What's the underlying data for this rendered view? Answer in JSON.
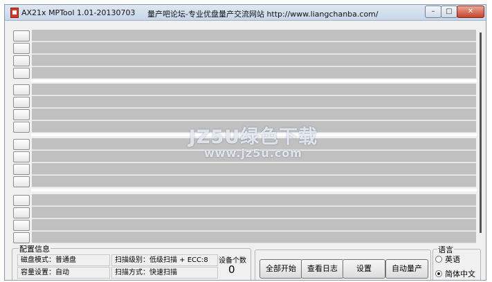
{
  "window": {
    "title": "AX21x MPTool 1.01-20130703",
    "site": "量产吧论坛-专业优盘量产交流网站 http://www.liangchanba.com/",
    "min_glyph": "–",
    "max_glyph": "□",
    "close_glyph": "✕"
  },
  "watermark": {
    "line1": "JZ5U绿色下载",
    "line2": "www.jz5u.com"
  },
  "config": {
    "title": "配置信息",
    "disk_mode": "磁盘模式：普通盘",
    "scan_level": "扫描级别：低级扫描 + ECC:8",
    "capacity": "容量设置：自动",
    "scan_method": "扫描方式：快速扫描"
  },
  "device_count": {
    "label": "设备个数",
    "value": "0"
  },
  "actions": {
    "start_all": "全部开始",
    "view_log": "查看日志",
    "settings": "设置",
    "auto_produce": "自动量产"
  },
  "language": {
    "title": "语言",
    "english": "英语",
    "chinese": "简体中文",
    "selected": "chinese"
  },
  "colors": {
    "port_bar": "#c0c0c0",
    "panel": "#f0f0f0",
    "title_bar": "#d6e2f0"
  }
}
